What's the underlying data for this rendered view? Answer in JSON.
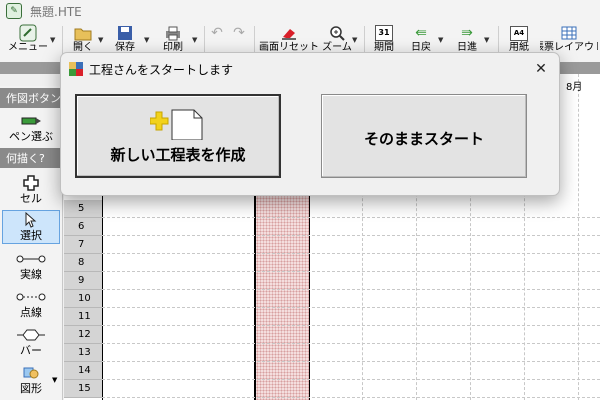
{
  "window": {
    "title": "無題.HTE"
  },
  "toolbar": {
    "menu": "メニュー",
    "open": "開く",
    "save": "保存",
    "print": "印刷",
    "screen_reset": "画面リセット",
    "zoom": "ズーム",
    "period": "期間",
    "calendar_day": "31",
    "day_back": "日戻",
    "day_forward": "日進",
    "paper": "用紙",
    "paper_badge": "A4",
    "form_layout": "帳票レイアウト"
  },
  "sidebar": {
    "draw_buttons_header": "作図ボタン",
    "pen_select": "ペン選ぶ",
    "what_to_draw_header": "何描く?",
    "items": [
      {
        "label": "セル",
        "icon": "cell-cross-icon"
      },
      {
        "label": "選択",
        "icon": "cursor-icon",
        "selected": true
      },
      {
        "label": "実線",
        "icon": "solid-line-icon"
      },
      {
        "label": "点線",
        "icon": "dotted-line-icon"
      },
      {
        "label": "バー",
        "icon": "bar-icon"
      },
      {
        "label": "図形",
        "icon": "shape-icon"
      }
    ]
  },
  "grid": {
    "month_label": "8月",
    "rows": [
      "5",
      "6",
      "7",
      "8",
      "9",
      "10",
      "11",
      "12",
      "13",
      "14",
      "15"
    ]
  },
  "dialog": {
    "title": "工程さんをスタートします",
    "new_schedule": "新しい工程表を作成",
    "start_as_is": "そのままスタート",
    "close": "✕"
  },
  "colors": {
    "hatch": "#f4dede",
    "selection_bg": "#cde5fb",
    "accent_red": "#d9202a"
  }
}
